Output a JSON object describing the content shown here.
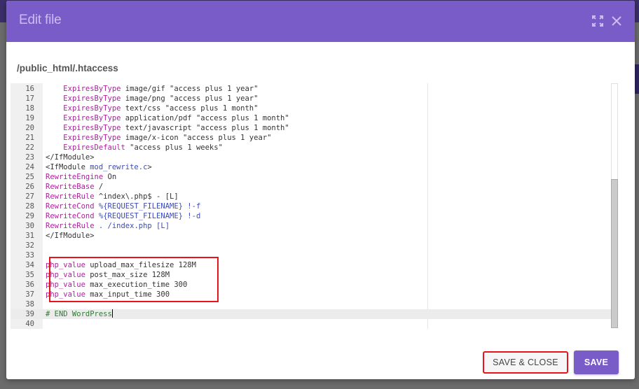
{
  "dialog": {
    "title": "Edit file",
    "file_path": "/public_html/.htaccess",
    "icons": {
      "expand": "expand-icon",
      "close": "close-icon"
    },
    "accent_color": "#7a5cc8",
    "highlight_color": "#e8141b"
  },
  "editor": {
    "cursor_line": 39,
    "scroll_position": 0.4,
    "lines": [
      {
        "n": "16",
        "tokens": [
          {
            "t": "    ",
            "c": ""
          },
          {
            "t": "ExpiresByType",
            "c": "kw"
          },
          {
            "t": " image/gif \"access plus 1 year\"",
            "c": ""
          }
        ]
      },
      {
        "n": "17",
        "tokens": [
          {
            "t": "    ",
            "c": ""
          },
          {
            "t": "ExpiresByType",
            "c": "kw"
          },
          {
            "t": " image/png \"access plus 1 year\"",
            "c": ""
          }
        ]
      },
      {
        "n": "18",
        "tokens": [
          {
            "t": "    ",
            "c": ""
          },
          {
            "t": "ExpiresByType",
            "c": "kw"
          },
          {
            "t": " text/css \"access plus 1 month\"",
            "c": ""
          }
        ]
      },
      {
        "n": "19",
        "tokens": [
          {
            "t": "    ",
            "c": ""
          },
          {
            "t": "ExpiresByType",
            "c": "kw"
          },
          {
            "t": " application/pdf \"access plus 1 month\"",
            "c": ""
          }
        ]
      },
      {
        "n": "20",
        "tokens": [
          {
            "t": "    ",
            "c": ""
          },
          {
            "t": "ExpiresByType",
            "c": "kw"
          },
          {
            "t": " text/javascript \"access plus 1 month\"",
            "c": ""
          }
        ]
      },
      {
        "n": "21",
        "tokens": [
          {
            "t": "    ",
            "c": ""
          },
          {
            "t": "ExpiresByType",
            "c": "kw"
          },
          {
            "t": " image/x-icon \"access plus 1 year\"",
            "c": ""
          }
        ]
      },
      {
        "n": "22",
        "tokens": [
          {
            "t": "    ",
            "c": ""
          },
          {
            "t": "ExpiresDefault",
            "c": "kw"
          },
          {
            "t": " \"access plus 1 weeks\"",
            "c": ""
          }
        ]
      },
      {
        "n": "23",
        "tokens": [
          {
            "t": "</IfModule>",
            "c": ""
          }
        ]
      },
      {
        "n": "24",
        "tokens": [
          {
            "t": "<IfModule ",
            "c": ""
          },
          {
            "t": "mod_rewrite.c",
            "c": "var"
          },
          {
            "t": ">",
            "c": ""
          }
        ]
      },
      {
        "n": "25",
        "tokens": [
          {
            "t": "RewriteEngine",
            "c": "kw"
          },
          {
            "t": " On",
            "c": ""
          }
        ]
      },
      {
        "n": "26",
        "tokens": [
          {
            "t": "RewriteBase",
            "c": "kw"
          },
          {
            "t": " /",
            "c": ""
          }
        ]
      },
      {
        "n": "27",
        "tokens": [
          {
            "t": "RewriteRule",
            "c": "kw"
          },
          {
            "t": " ^index\\.php$ - [L]",
            "c": ""
          }
        ]
      },
      {
        "n": "28",
        "tokens": [
          {
            "t": "RewriteCond",
            "c": "kw"
          },
          {
            "t": " %{REQUEST_FILENAME} !-f",
            "c": "var"
          }
        ]
      },
      {
        "n": "29",
        "tokens": [
          {
            "t": "RewriteCond",
            "c": "kw"
          },
          {
            "t": " %{REQUEST_FILENAME} !-d",
            "c": "var"
          }
        ]
      },
      {
        "n": "30",
        "tokens": [
          {
            "t": "RewriteRule",
            "c": "kw"
          },
          {
            "t": " . /index.php [L]",
            "c": "var"
          }
        ]
      },
      {
        "n": "31",
        "tokens": [
          {
            "t": "</IfModule>",
            "c": ""
          }
        ]
      },
      {
        "n": "32",
        "tokens": []
      },
      {
        "n": "33",
        "tokens": []
      },
      {
        "n": "34",
        "tokens": [
          {
            "t": "php_value",
            "c": "kw"
          },
          {
            "t": " upload_max_filesize 128M",
            "c": ""
          }
        ]
      },
      {
        "n": "35",
        "tokens": [
          {
            "t": "php_value",
            "c": "kw"
          },
          {
            "t": " post_max_size 128M",
            "c": ""
          }
        ]
      },
      {
        "n": "36",
        "tokens": [
          {
            "t": "php_value",
            "c": "kw"
          },
          {
            "t": " max_execution_time 300",
            "c": ""
          }
        ]
      },
      {
        "n": "37",
        "tokens": [
          {
            "t": "php_value",
            "c": "kw"
          },
          {
            "t": " max_input_time 300",
            "c": ""
          }
        ]
      },
      {
        "n": "38",
        "tokens": []
      },
      {
        "n": "39",
        "tokens": [
          {
            "t": "# END WordPress",
            "c": "cm"
          }
        ]
      },
      {
        "n": "40",
        "tokens": []
      }
    ]
  },
  "footer": {
    "save_close_label": "SAVE & CLOSE",
    "save_label": "SAVE"
  }
}
